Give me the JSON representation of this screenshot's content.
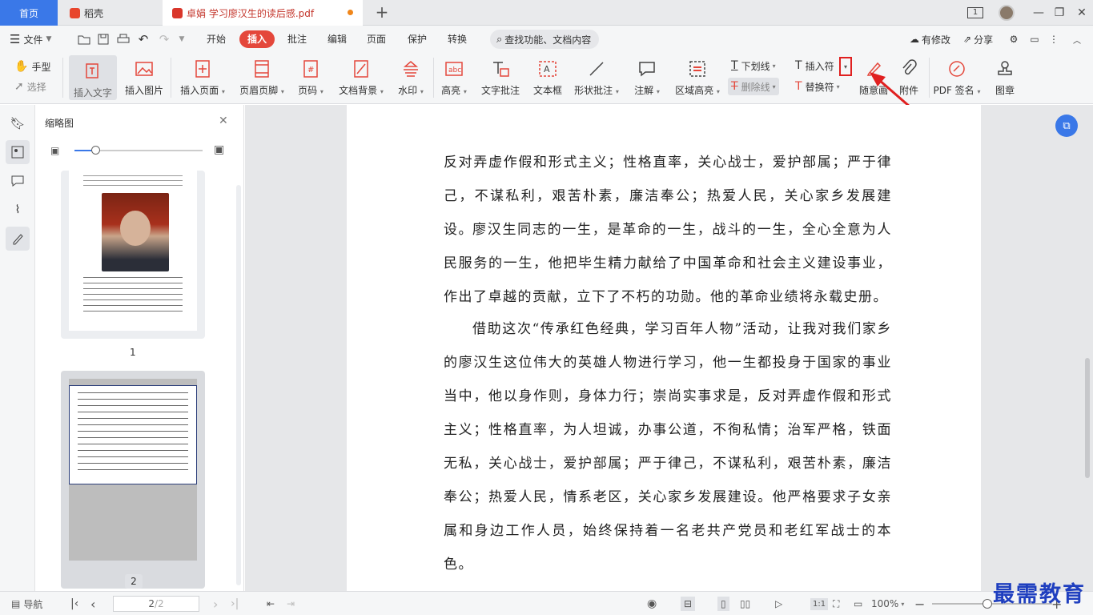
{
  "tabs": {
    "home": "首页",
    "daoke": "稻壳",
    "doc": "卓娟 学习廖汉生的读后感.pdf"
  },
  "window": {
    "badge": "1"
  },
  "menu": {
    "file": "文件",
    "items": [
      "开始",
      "插入",
      "批注",
      "编辑",
      "页面",
      "保护",
      "转换"
    ],
    "active": "插入",
    "search": "查找功能、文档内容",
    "modified": "有修改",
    "share": "分享"
  },
  "ribbon": {
    "hand": "手型",
    "select": "选择",
    "insert_text": "插入文字",
    "insert_image": "插入图片",
    "insert_page": "插入页面",
    "header_footer": "页眉页脚",
    "page_number": "页码",
    "doc_background": "文档背景",
    "watermark": "水印",
    "highlight": "高亮",
    "text_comment": "文字批注",
    "text_box": "文本框",
    "shape_comment": "形状批注",
    "annotation": "注解",
    "area_highlight": "区域高亮",
    "underline": "下划线",
    "strikethrough": "删除线",
    "insert_symbol": "插入符",
    "replace_symbol": "替换符",
    "freehand": "随意画",
    "attachment": "附件",
    "pdf_sign": "PDF 签名",
    "stamp": "图章"
  },
  "thumbs": {
    "title": "缩略图",
    "page1": "1",
    "page2": "2"
  },
  "document": {
    "p1": "反对弄虚作假和形式主义；性格直率，关心战士，爱护部属；严于律己，不谋私利，艰苦朴素，廉洁奉公；热爱人民，关心家乡发展建设。",
    "p2": "廖汉生同志的一生，是革命的一生，战斗的一生，全心全意为人民服务的一生，他把毕生精力献给了中国革命和社会主义建设事业，作出了卓越的贡献，立下了不朽的功勋。他的革命业绩将永载史册。",
    "p3": "借助这次“传承红色经典，学习百年人物”活动，让我对我们家乡的廖汉生这位伟大的英雄人物进行学习，他一生都投身于国家的事业当中，他以身作则，身体力行；崇尚实事求是，反对弄虚作假和形式主义；性格直率，为人坦诚，办事公道，不徇私情；治军严格，铁面无私，关心战士，爱护部属；严于律己，不谋私利，艰苦朴素，廉洁奉公；热爱人民，情系老区，关心家乡发展建设。他严格要求子女亲属和身边工作人员，始终保持着一名老共产党员和老红军战士的本色。"
  },
  "status": {
    "nav": "导航",
    "page_current": "2",
    "page_total": "/2",
    "zoom": "100%"
  },
  "watermark": "最需教育",
  "colors": {
    "accent": "#3a78e8",
    "insert_tab": "#e4473b",
    "highlight_box": "#e02020"
  }
}
